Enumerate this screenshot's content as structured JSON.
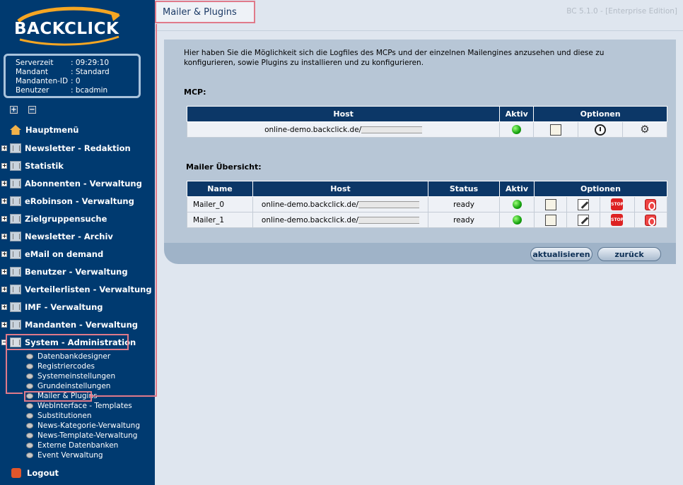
{
  "sidebar": {
    "logo_text": "BACKCLICK",
    "server_info": [
      {
        "label": "Serverzeit",
        "value": ": 09:29:10"
      },
      {
        "label": "Mandant",
        "value": ": Standard"
      },
      {
        "label": "Mandanten-ID",
        "value": ": 0"
      },
      {
        "label": "Benutzer",
        "value": ": bcadmin"
      }
    ],
    "nav": [
      "Hauptmenü",
      "Newsletter - Redaktion",
      "Statistik",
      "Abonnenten - Verwaltung",
      "eRobinson - Verwaltung",
      "Zielgruppensuche",
      "Newsletter - Archiv",
      "eMail on demand",
      "Benutzer - Verwaltung",
      "Verteilerlisten - Verwaltung",
      "IMF - Verwaltung",
      "Mandanten - Verwaltung",
      "System - Administration"
    ],
    "sub_nav": [
      "Datenbankdesigner",
      "Registriercodes",
      "Systemeinstellungen",
      "Grundeinstellungen",
      "Mailer & Plugins",
      "WebInterface - Templates",
      "Substitutionen",
      "News-Kategorie-Verwaltung",
      "News-Template-Verwaltung",
      "Externe Datenbanken",
      "Event Verwaltung"
    ],
    "logout": "Logout"
  },
  "header": {
    "title": "Mailer & Plugins",
    "version": "BC 5.1.0 - [Enterprise Edition]"
  },
  "main": {
    "intro": "Hier haben Sie die Möglichkeit sich die Logfiles des MCPs und der einzelnen Mailengines anzusehen und diese zu konfigurieren, sowie Plugins zu installieren und zu konfigurieren.",
    "mcp_label": "MCP:",
    "mcp_table": {
      "headers": [
        "Host",
        "Aktiv",
        "Optionen"
      ],
      "rows": [
        {
          "host": "online-demo.backclick.de/"
        }
      ]
    },
    "mailer_label": "Mailer Übersicht:",
    "mailer_table": {
      "headers": [
        "Name",
        "Host",
        "Status",
        "Aktiv",
        "Optionen"
      ],
      "rows": [
        {
          "name": "Mailer_0",
          "host": "online-demo.backclick.de/",
          "status": "ready"
        },
        {
          "name": "Mailer_1",
          "host": "online-demo.backclick.de/",
          "status": "ready"
        }
      ]
    },
    "buttons": {
      "refresh": "aktualisieren",
      "back": "zurück"
    }
  },
  "colors": {
    "sidebar_bg": "#003a70",
    "table_header": "#0c3767",
    "highlight": "#e07a8a",
    "panel": "#b7c6d6"
  }
}
